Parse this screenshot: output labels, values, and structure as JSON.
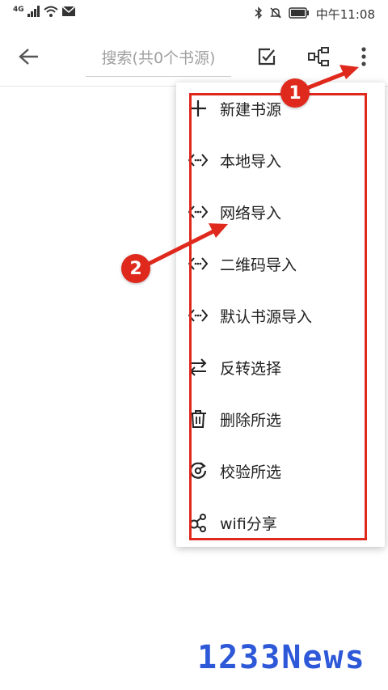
{
  "status_bar": {
    "network": "4G",
    "time": "中午11:08"
  },
  "toolbar": {
    "search_placeholder": "搜索(共0个书源)"
  },
  "menu": {
    "items": [
      {
        "label": "新建书源",
        "icon": "plus-icon"
      },
      {
        "label": "本地导入",
        "icon": "code-arrows-icon"
      },
      {
        "label": "网络导入",
        "icon": "code-arrows-icon"
      },
      {
        "label": "二维码导入",
        "icon": "code-arrows-icon"
      },
      {
        "label": "默认书源导入",
        "icon": "code-arrows-icon"
      },
      {
        "label": "反转选择",
        "icon": "swap-icon"
      },
      {
        "label": "删除所选",
        "icon": "trash-icon"
      },
      {
        "label": "校验所选",
        "icon": "verify-icon"
      },
      {
        "label": "wifi分享",
        "icon": "share-icon"
      }
    ]
  },
  "annotations": {
    "badge_1": "1",
    "badge_2": "2",
    "accent_color": "#e0291d"
  },
  "watermark": "1233News"
}
